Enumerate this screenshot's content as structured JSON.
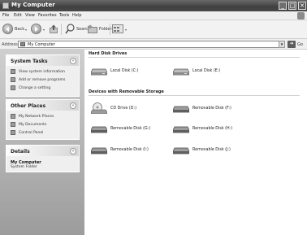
{
  "window": {
    "title": "My Computer"
  },
  "menu": [
    "File",
    "Edit",
    "View",
    "Favorites",
    "Tools",
    "Help"
  ],
  "toolbar": {
    "back": "Back",
    "search": "Search",
    "folders": "Folders"
  },
  "address": {
    "label": "Address",
    "value": "My Computer",
    "go": "Go"
  },
  "sidebar": {
    "system_tasks": {
      "title": "System Tasks",
      "items": [
        "View system information",
        "Add or remove programs",
        "Change a setting"
      ]
    },
    "other_places": {
      "title": "Other Places",
      "items": [
        "My Network Places",
        "My Documents",
        "Control Panel"
      ]
    },
    "details": {
      "title": "Details",
      "name": "My Computer",
      "type": "System Folder"
    }
  },
  "content": {
    "hard_drives": {
      "title": "Hard Disk Drives",
      "items": [
        "Local Disk (C:)",
        "Local Disk (E:)"
      ]
    },
    "removable": {
      "title": "Devices with Removable Storage",
      "items": [
        "CD Drive (D:)",
        "Removable Disk (F:)",
        "Removable Disk (G:)",
        "Removable Disk (H:)",
        "Removable Disk (I:)",
        "Removable Disk (J:)"
      ]
    }
  }
}
